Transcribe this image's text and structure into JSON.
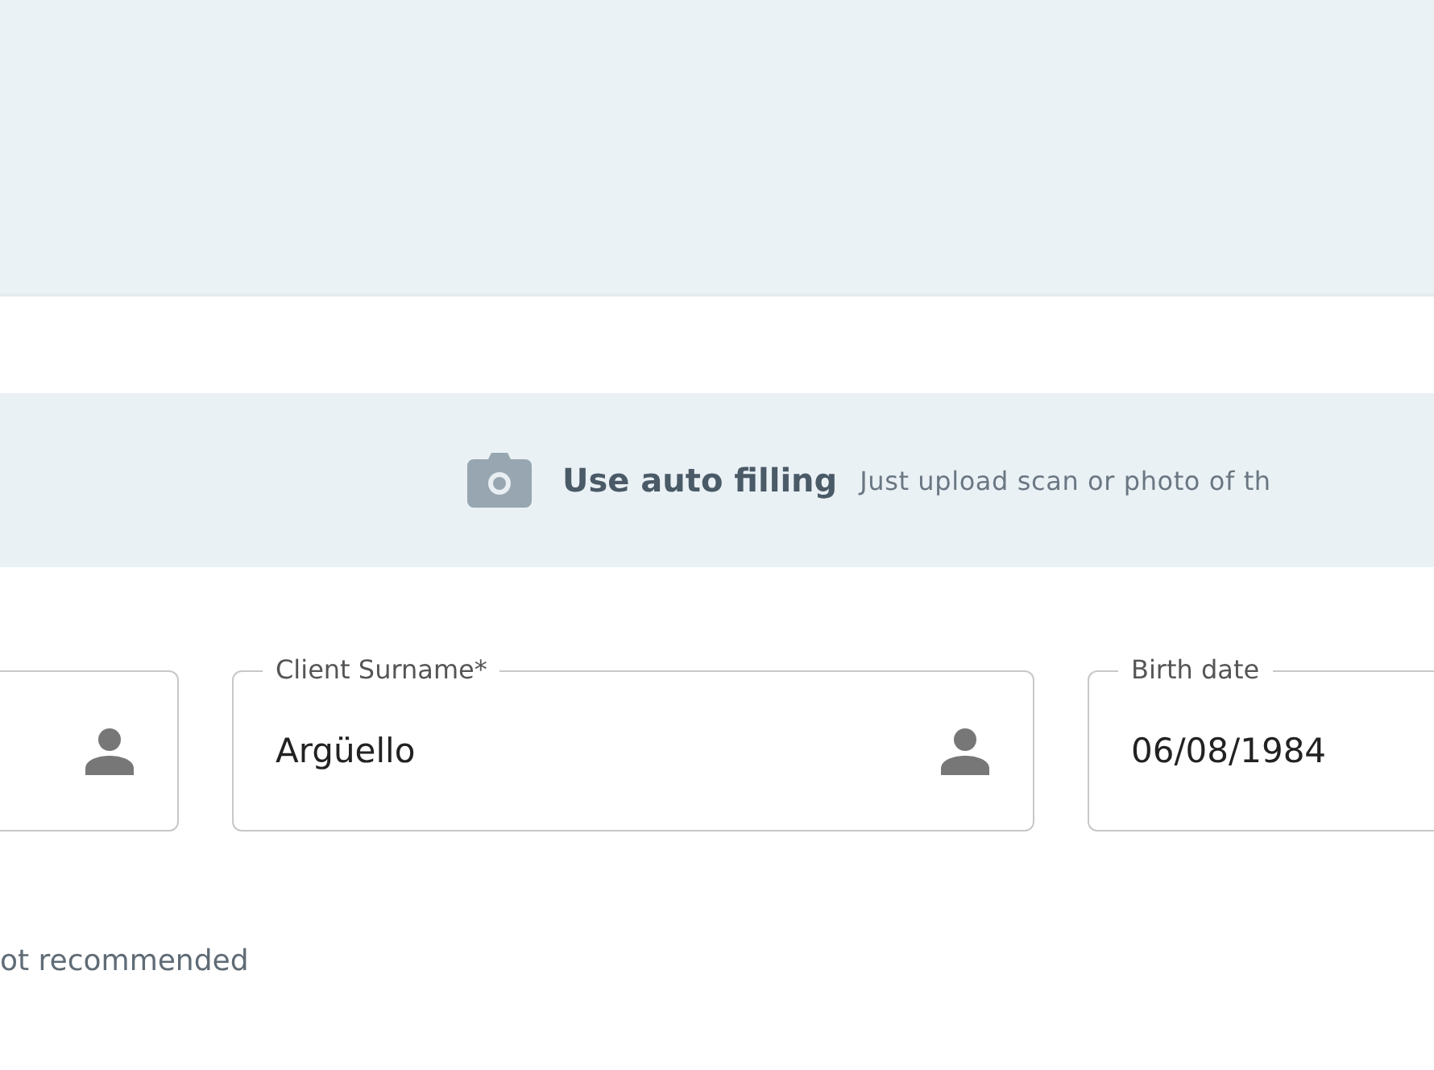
{
  "autofill_banner": {
    "title": "Use auto filling",
    "hint": "Just upload scan or photo of th"
  },
  "fields": [
    {
      "icon": true
    },
    {
      "label": "Client Surname*",
      "value": "Argüello",
      "icon": true
    },
    {
      "label": "Birth date",
      "value": "06/08/1984",
      "icon": false
    }
  ],
  "note": "ot recommended"
}
